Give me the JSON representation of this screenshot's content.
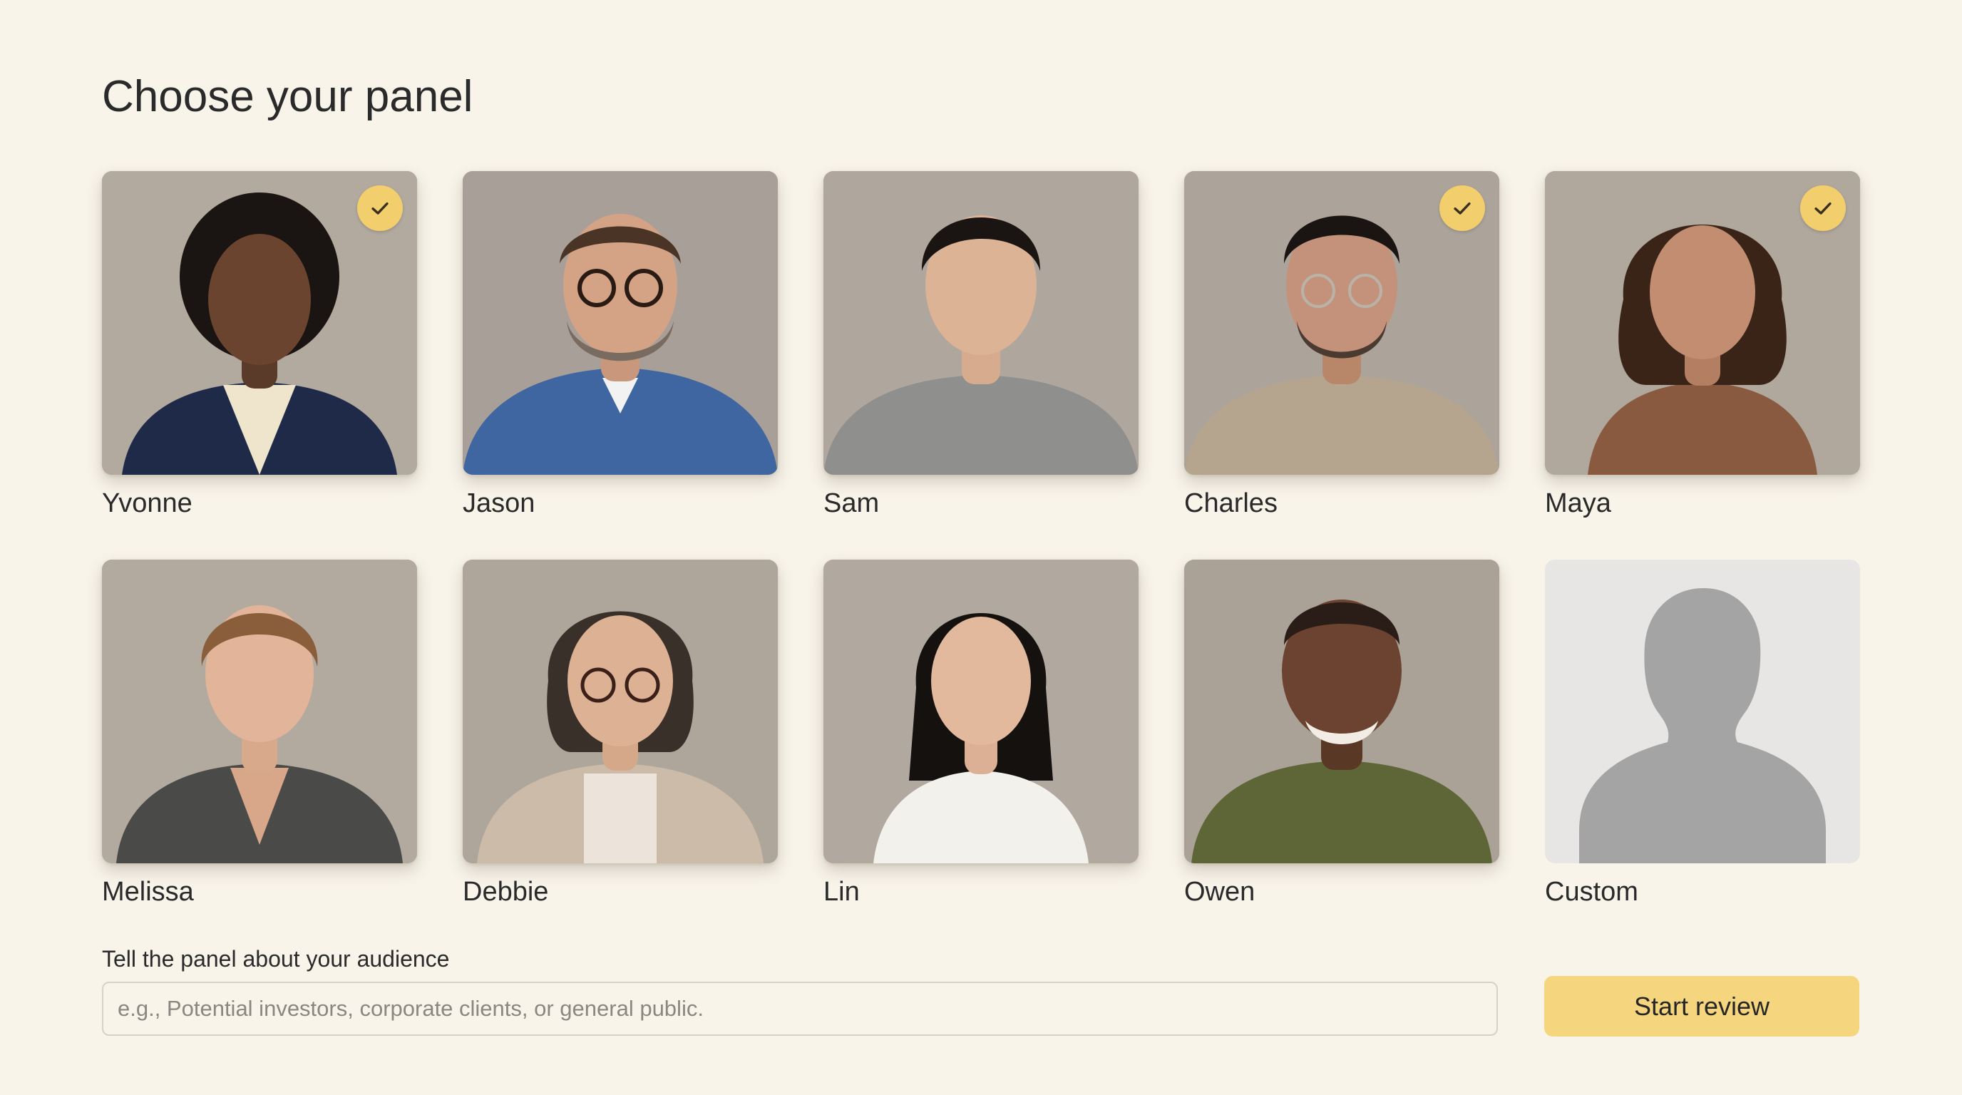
{
  "page": {
    "title": "Choose your panel"
  },
  "colors": {
    "background": "#f8f4ea",
    "accent": "#f5d57d",
    "check_badge": "#f2cf6c",
    "photo_backdrop": "#b5aca2"
  },
  "panelists": [
    {
      "name": "Yvonne",
      "selected": true,
      "icon": "portrait-photo"
    },
    {
      "name": "Jason",
      "selected": false,
      "icon": "portrait-photo"
    },
    {
      "name": "Sam",
      "selected": false,
      "icon": "portrait-photo"
    },
    {
      "name": "Charles",
      "selected": true,
      "icon": "portrait-photo"
    },
    {
      "name": "Maya",
      "selected": true,
      "icon": "portrait-photo"
    },
    {
      "name": "Melissa",
      "selected": false,
      "icon": "portrait-photo"
    },
    {
      "name": "Debbie",
      "selected": false,
      "icon": "portrait-photo"
    },
    {
      "name": "Lin",
      "selected": false,
      "icon": "portrait-photo"
    },
    {
      "name": "Owen",
      "selected": false,
      "icon": "portrait-photo"
    },
    {
      "name": "Custom",
      "selected": false,
      "icon": "person-silhouette-icon"
    }
  ],
  "audience": {
    "label": "Tell the panel about your audience",
    "value": "",
    "placeholder": "e.g., Potential investors, corporate clients, or general public."
  },
  "actions": {
    "start_label": "Start review"
  }
}
